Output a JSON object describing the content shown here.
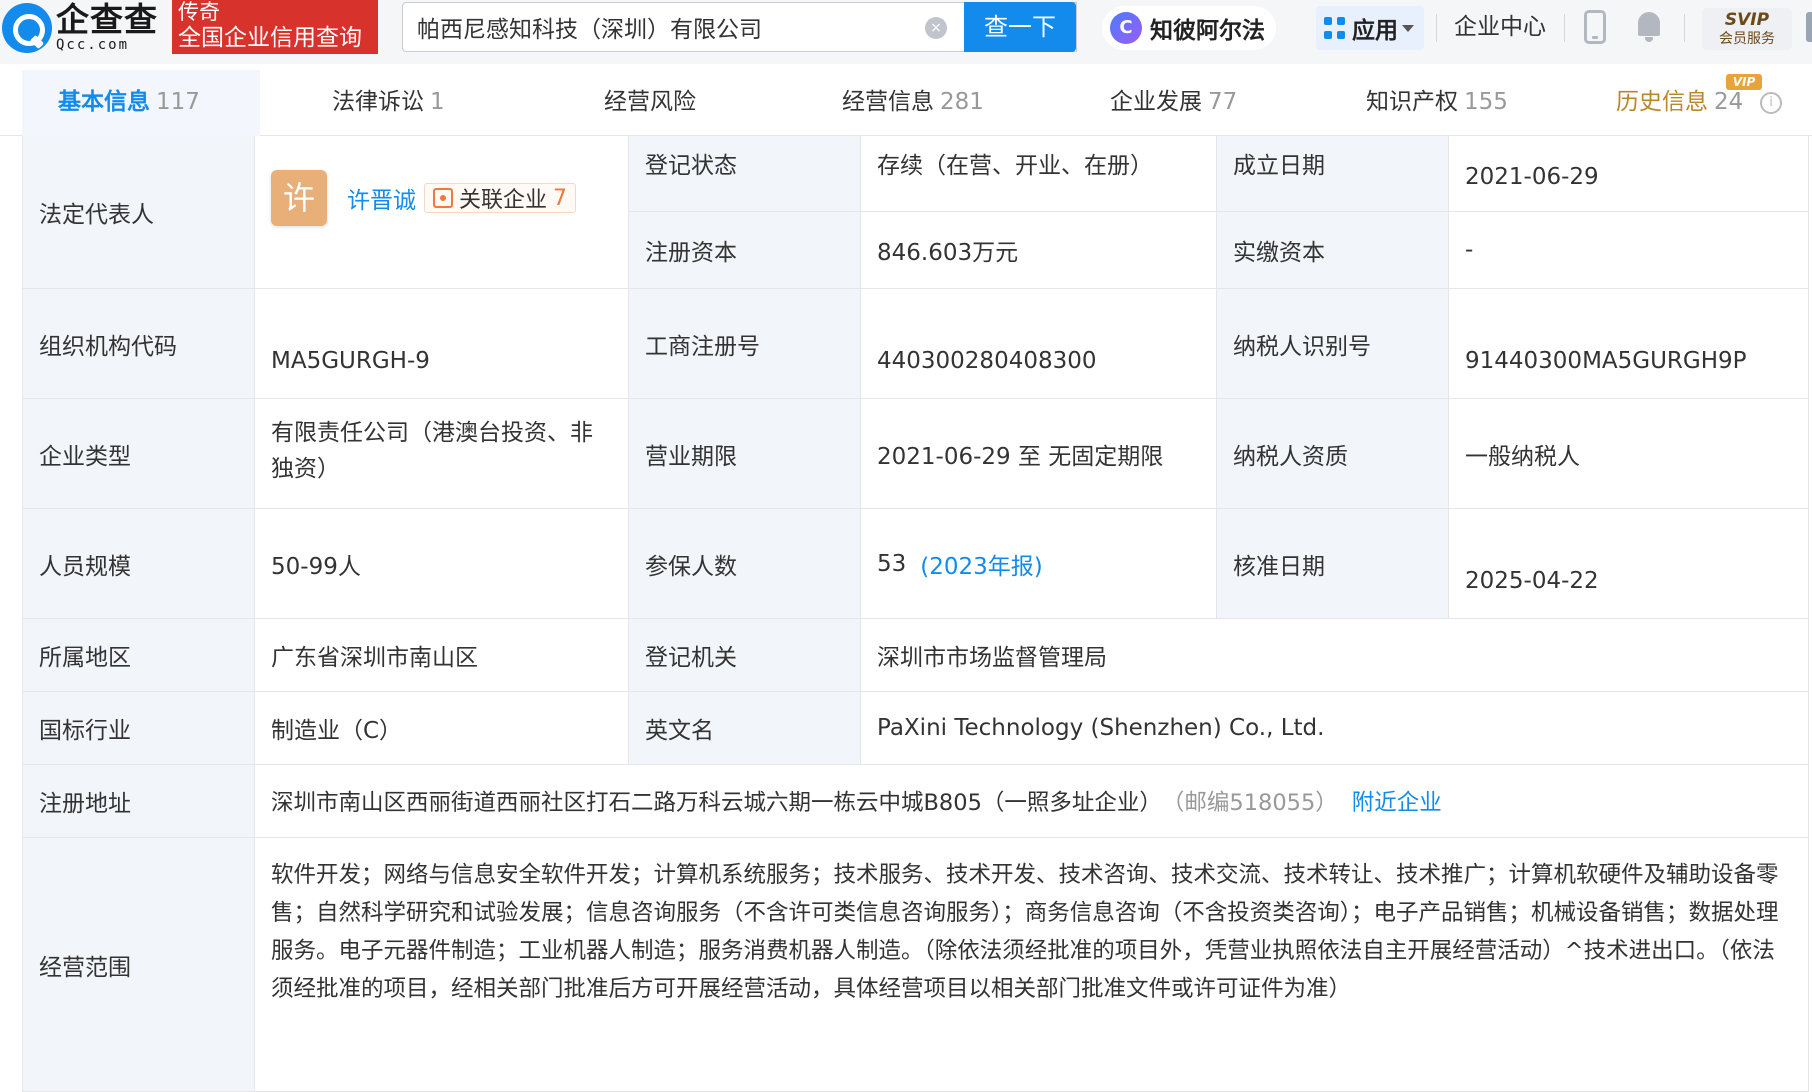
{
  "header": {
    "logo_cn": "企查查",
    "logo_en": "Qcc.com",
    "banner_line1": "传奇",
    "banner_line2": "全国企业信用查询",
    "search_value": "帕西尼感知科技（深圳）有限公司",
    "clear_glyph": "×",
    "search_button": "查一下",
    "ai_icon_glyph": "C",
    "ai_label": "知彼阿尔法",
    "apps_label": "应用",
    "enterprise_center": "企业中心",
    "svip_title": "SVIP",
    "svip_sub": "会员服务",
    "icons": [
      "search-clear-icon",
      "ai-assistant-icon",
      "apps-grid-icon",
      "chevron-down-icon",
      "phone-icon",
      "bell-icon",
      "svip-crown-icon"
    ]
  },
  "tabs": [
    {
      "label": "基本信息",
      "count": "117",
      "active": true
    },
    {
      "label": "法律诉讼",
      "count": "1"
    },
    {
      "label": "经营风险",
      "count": ""
    },
    {
      "label": "经营信息",
      "count": "281"
    },
    {
      "label": "企业发展",
      "count": "77"
    },
    {
      "label": "知识产权",
      "count": "155"
    },
    {
      "label": "历史信息",
      "count": "24",
      "badge": "VIP",
      "info_glyph": "i"
    }
  ],
  "info": {
    "legal_rep_label": "法定代表人",
    "legal_rep_avatar": "许",
    "legal_rep_name": "许晋诚",
    "related_label": "关联企业",
    "related_count": "7",
    "reg_status_label": "登记状态",
    "reg_status": "存续（在营、开业、在册）",
    "found_date_label": "成立日期",
    "found_date": "2021-06-29",
    "reg_capital_label": "注册资本",
    "reg_capital": "846.603万元",
    "paid_capital_label": "实缴资本",
    "paid_capital": "-",
    "org_code_label": "组织机构代码",
    "org_code": "MA5GURGH-9",
    "biz_reg_no_label": "工商注册号",
    "biz_reg_no": "440300280408300",
    "tax_id_label": "纳税人识别号",
    "tax_id": "91440300MA5GURGH9P",
    "ent_type_label": "企业类型",
    "ent_type": "有限责任公司（港澳台投资、非独资）",
    "biz_term_label": "营业期限",
    "biz_term": "2021-06-29 至 无固定期限",
    "taxpayer_label": "纳税人资质",
    "taxpayer": "一般纳税人",
    "staff_label": "人员规模",
    "staff": "50-99人",
    "insured_label": "参保人数",
    "insured": "53",
    "insured_year": "(2023年报)",
    "approve_date_label": "核准日期",
    "approve_date": "2025-04-22",
    "region_label": "所属地区",
    "region": "广东省深圳市南山区",
    "reg_authority_label": "登记机关",
    "reg_authority": "深圳市市场监督管理局",
    "industry_label": "国标行业",
    "industry": "制造业（C）",
    "en_name_label": "英文名",
    "en_name": "PaXini Technology (Shenzhen) Co., Ltd.",
    "address_label": "注册地址",
    "address": "深圳市南山区西丽街道西丽社区打石二路万科云城六期一栋云中城B805（一照多址企业）",
    "postcode": "（邮编518055）",
    "nearby_link": "附近企业",
    "scope_label": "经营范围",
    "scope": "软件开发；网络与信息安全软件开发；计算机系统服务；技术服务、技术开发、技术咨询、技术交流、技术转让、技术推广；计算机软硬件及辅助设备零售；自然科学研究和试验发展；信息咨询服务（不含许可类信息咨询服务）；商务信息咨询（不含投资类咨询）；电子产品销售；机械设备销售；数据处理服务。电子元器件制造；工业机器人制造；服务消费机器人制造。（除依法须经批准的项目外，凭营业执照依法自主开展经营活动）^技术进出口。（依法须经批准的项目，经相关部门批准后方可开展经营活动，具体经营项目以相关部门批准文件或许可证件为准）"
  },
  "colors": {
    "accent": "#128bed",
    "brand_red": "#d7332c",
    "label_bg": "#f2f5f9",
    "related_orange": "#f07a3c",
    "vip_gold": "#b8862b"
  }
}
